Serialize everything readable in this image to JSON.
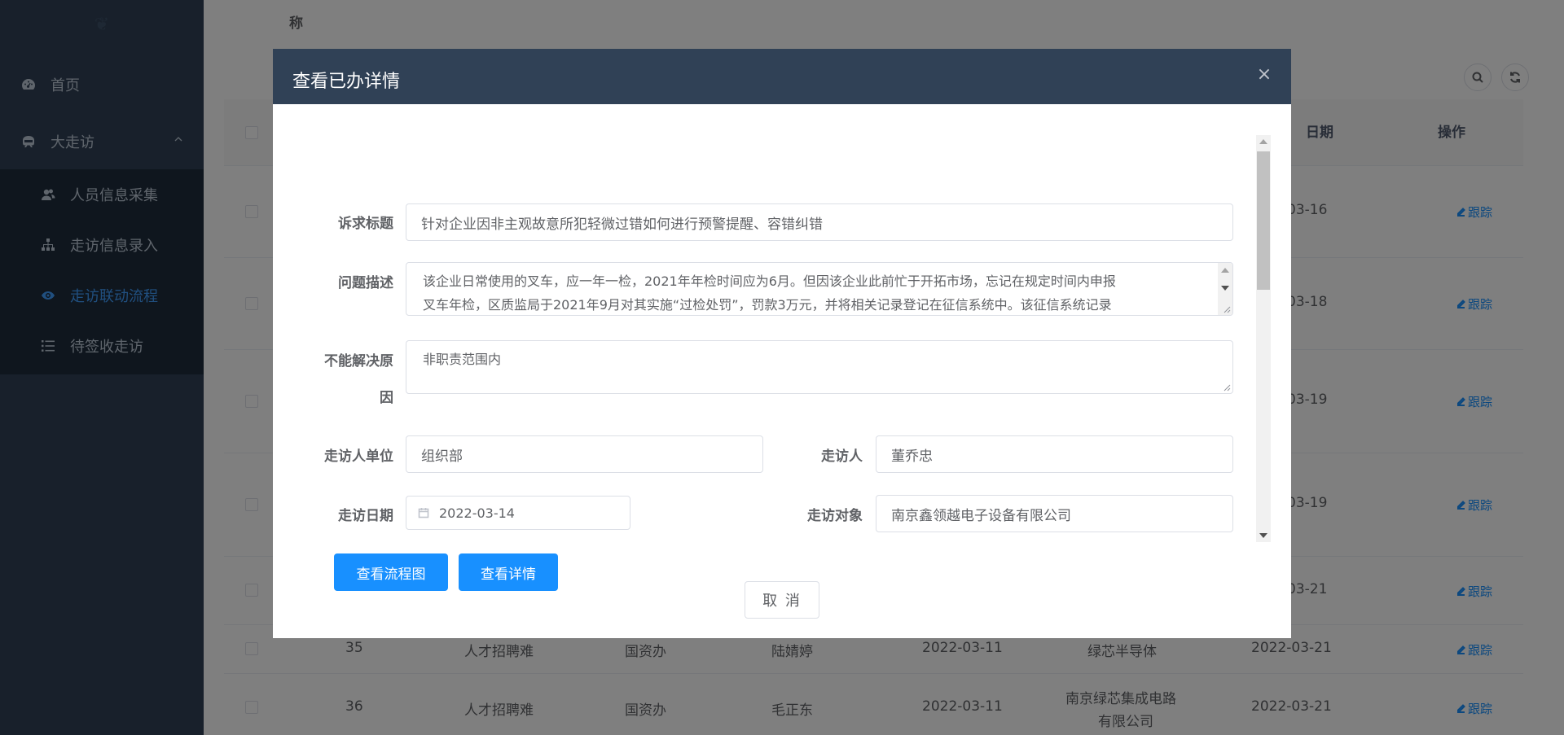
{
  "sidebar": {
    "items": [
      {
        "label": "首页",
        "icon": "dashboard-icon"
      },
      {
        "label": "大走访",
        "icon": "visit-icon"
      }
    ],
    "submenu": [
      {
        "label": "人员信息采集",
        "icon": "user-group-icon",
        "active": false
      },
      {
        "label": "走访信息录入",
        "icon": "tree-structure-icon",
        "active": false
      },
      {
        "label": "走访联动流程",
        "icon": "eye-icon",
        "active": true
      },
      {
        "label": "待签收走访",
        "icon": "list-icon",
        "active": false
      }
    ]
  },
  "main": {
    "top_label": "称",
    "table": {
      "headers": {
        "date": "日期",
        "action": "操作"
      },
      "rows": [
        {
          "date": "03-16",
          "action": "跟踪"
        },
        {
          "date": "03-18",
          "action": "跟踪"
        },
        {
          "date": "03-19",
          "action": "跟踪"
        },
        {
          "date": "03-19",
          "action": "跟踪"
        },
        {
          "date": "03-21",
          "action": "跟踪"
        },
        {
          "id": "35",
          "issue": "人才招聘难",
          "dept": "国资办",
          "person": "陆婧婷",
          "visit_date": "2022-03-11",
          "company": "绿芯半导体",
          "date": "2022-03-21",
          "action": "跟踪"
        },
        {
          "id": "36",
          "issue": "人才招聘难",
          "dept": "国资办",
          "person": "毛正东",
          "visit_date": "2022-03-11",
          "company_line1": "南京绿芯集成电路",
          "company_line2": "有限公司",
          "date": "2022-03-21",
          "action": "跟踪"
        }
      ]
    }
  },
  "dialog": {
    "title": "查看已办详情",
    "fields": {
      "title_label": "诉求标题",
      "title_value": "针对企业因非主观故意所犯轻微过错如何进行预警提醒、容错纠错",
      "desc_label": "问题描述",
      "desc_line1": "该企业日常使用的叉车，应一年一检，2021年年检时间应为6月。但因该企业此前忙于开拓市场，忘记在规定时间内申报",
      "desc_line2": "叉车年检，区质监局于2021年9月对其实施“过检处罚”，罚款3万元，并将相关记录登记在征信系统中。该征信系统记录",
      "reason_label_line1": "不能解决原",
      "reason_label_line2": "因",
      "reason_value": "非职责范围内",
      "unit_label": "走访人单位",
      "unit_value": "组织部",
      "visitor_label": "走访人",
      "visitor_value": "董乔忠",
      "date_label": "走访日期",
      "date_value": "2022-03-14",
      "target_label": "走访对象",
      "target_value": "南京鑫领越电子设备有限公司"
    },
    "buttons": {
      "flow": "查看流程图",
      "detail": "查看详情",
      "cancel": "取 消"
    }
  }
}
